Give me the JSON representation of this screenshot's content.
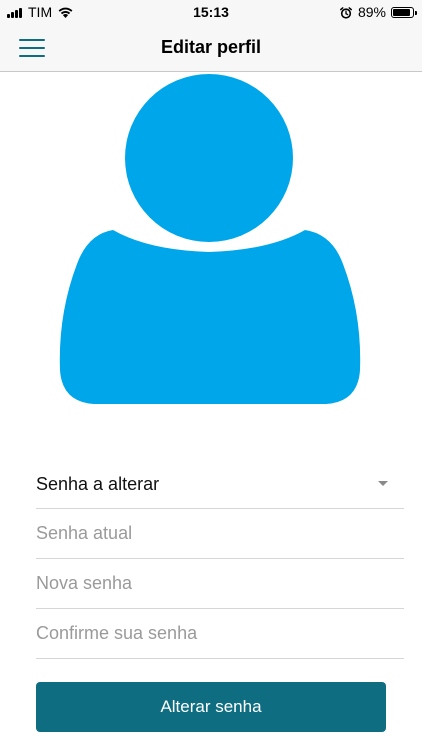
{
  "status_bar": {
    "carrier": "TIM",
    "time": "15:13",
    "battery_percent": "89%",
    "battery_level": 0.89,
    "icons": [
      "signal-icon",
      "wifi-icon",
      "alarm-icon",
      "battery-icon"
    ]
  },
  "header": {
    "title": "Editar perfil",
    "menu_icon": "hamburger-menu-icon"
  },
  "avatar": {
    "icon": "user-avatar-icon",
    "color": "#00a6ea"
  },
  "form": {
    "password_select": {
      "value": "Senha a alterar"
    },
    "current_password": {
      "placeholder": "Senha atual",
      "value": ""
    },
    "new_password": {
      "placeholder": "Nova senha",
      "value": ""
    },
    "confirm_password": {
      "placeholder": "Confirme sua senha",
      "value": ""
    },
    "submit_label": "Alterar senha"
  },
  "colors": {
    "primary": "#0e6d80",
    "avatar": "#00a6ea",
    "header_background": "#f7f7f7",
    "placeholder_text": "#9a9a9a",
    "divider": "#d6d6d6"
  }
}
